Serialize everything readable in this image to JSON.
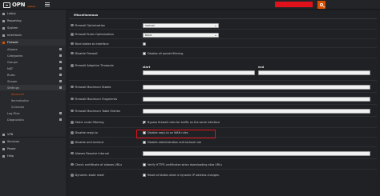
{
  "header": {
    "logo_text": "OPN",
    "logo_sub": "sense",
    "search_icon": "search-icon",
    "colors": {
      "accent": "#d94f00",
      "redaction": "#e0111a"
    }
  },
  "sidebar": {
    "items": [
      {
        "label": "Lobby",
        "icon": "home-icon"
      },
      {
        "label": "Reporting",
        "icon": "chart-icon"
      },
      {
        "label": "System",
        "icon": "computer-icon"
      },
      {
        "label": "Interfaces",
        "icon": "sitemap-icon"
      },
      {
        "label": "Firewall",
        "icon": "fire-icon"
      },
      {
        "label": "Aliases",
        "icon": "list-icon"
      },
      {
        "label": "Categories",
        "icon": "tags-icon"
      },
      {
        "label": "Groups",
        "icon": "sitemap-icon"
      },
      {
        "label": "NAT",
        "icon": "exchange-icon"
      },
      {
        "label": "Rules",
        "icon": "check-icon"
      },
      {
        "label": "Shaper",
        "icon": "filter-icon"
      },
      {
        "label": "Settings",
        "icon": "cog-icon"
      },
      {
        "label": "Advanced"
      },
      {
        "label": "Normalization"
      },
      {
        "label": "Schedules"
      },
      {
        "label": "Log Files",
        "icon": "eye-icon"
      },
      {
        "label": "Diagnostics",
        "icon": "medkit-icon"
      },
      {
        "label": "VPN",
        "icon": "lock-icon"
      },
      {
        "label": "Services",
        "icon": "cogs-icon"
      },
      {
        "label": "Power",
        "icon": "plug-icon"
      },
      {
        "label": "Help",
        "icon": "support-icon"
      }
    ]
  },
  "main": {
    "section_title": "Miscellaneous",
    "rows": [
      {
        "label": "Firewall Optimization",
        "select": "normal"
      },
      {
        "label": "Firewall Rules Optimization",
        "select": "basic"
      },
      {
        "label": "Bind states to interface"
      },
      {
        "label": "Disable Firewall",
        "checkbox_label": "Disable all packet filtering."
      },
      {
        "label": "Firewall Adaptive Timeouts",
        "col_start": "start",
        "col_end": "end"
      },
      {
        "label": "Firewall Maximum States"
      },
      {
        "label": "Firewall Maximum Fragments"
      },
      {
        "label": "Firewall Maximum Table Entries"
      },
      {
        "label": "Static route filtering",
        "checkbox_label": "Bypass firewall rules for traffic on the same interface",
        "checked": true
      },
      {
        "label": "Disable reply-to",
        "checkbox_label": "Disable reply-to on WAN rules"
      },
      {
        "label": "Disable anti-lockout",
        "checkbox_label": "Disable administration anti-lockout rule"
      },
      {
        "label": "Aliases Resolve Interval"
      },
      {
        "label": "Check certificate of aliases URLs",
        "checkbox_label": "Verify HTTPS certificates when downloading alias URLs"
      },
      {
        "label": "Dynamic state reset",
        "checkbox_label": "Reset all states when a dynamic IP address changes."
      }
    ]
  }
}
